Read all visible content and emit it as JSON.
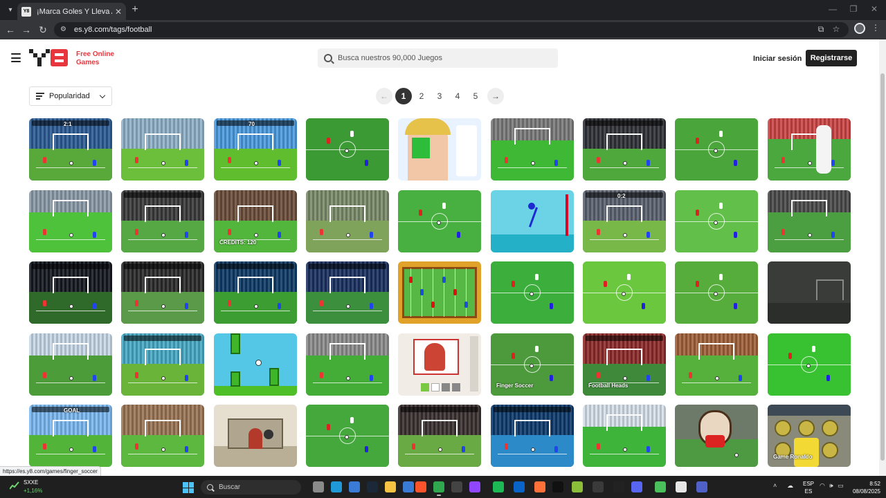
{
  "browser": {
    "tab_title": "¡Marca Goles Y Lleva A Tu Equipo",
    "favicon_text": "Y8",
    "url": "es.y8.com/tags/football",
    "status_url": "https://es.y8.com/games/finger_soccer"
  },
  "header": {
    "logo_text_line1": "Free Online",
    "logo_text_line2": "Games",
    "search_placeholder": "Busca nuestros 90,000 Juegos",
    "login_label": "Iniciar sesión",
    "register_label": "Registrarse",
    "brand_color": "#e8363e"
  },
  "controls": {
    "sort_label": "Popularidad",
    "pages": [
      "1",
      "2",
      "3",
      "4",
      "5"
    ],
    "current_page": "1",
    "prev_arrow": "←",
    "next_arrow": "→"
  },
  "games": [
    {
      "name": "game-1",
      "style": "stadium-dark",
      "sky": "#2b5b94",
      "grass": "#58a83a",
      "label": "2:1"
    },
    {
      "name": "game-2",
      "style": "penalty",
      "sky": "#8fb0c8",
      "grass": "#6bbf3b",
      "label": ""
    },
    {
      "name": "game-3",
      "style": "cartoon",
      "sky": "#4a9bdf",
      "grass": "#5fbd2e",
      "label": "70"
    },
    {
      "name": "game-4",
      "style": "topdown",
      "sky": "#3c9a35",
      "grass": "#3c9a35",
      "label": ""
    },
    {
      "name": "game-5",
      "style": "faceart",
      "sky": "#e8f3ff",
      "grass": "#bde0ff",
      "label": ""
    },
    {
      "name": "game-6",
      "style": "goal-net",
      "sky": "#7a7a7a",
      "grass": "#3fb836",
      "label": ""
    },
    {
      "name": "game-7",
      "style": "stadium-dark",
      "sky": "#303038",
      "grass": "#4ea83c",
      "label": ""
    },
    {
      "name": "game-8",
      "style": "topdown",
      "sky": "#4aa63a",
      "grass": "#4aa63a",
      "label": ""
    },
    {
      "name": "game-9",
      "style": "kicker",
      "sky": "#c44",
      "grass": "#4aa83f",
      "label": ""
    },
    {
      "name": "game-10",
      "style": "goal-net",
      "sky": "#8a9aa8",
      "grass": "#4ec23a",
      "label": ""
    },
    {
      "name": "game-11",
      "style": "stadium-dark",
      "sky": "#3a3a3a",
      "grass": "#56a845",
      "label": ""
    },
    {
      "name": "game-12",
      "style": "penalty",
      "sky": "#6b4d3a",
      "grass": "#52b63c",
      "label": "CREDITS: 120"
    },
    {
      "name": "game-13",
      "style": "field-real",
      "sky": "#7a8a6a",
      "grass": "#7fa35a",
      "label": ""
    },
    {
      "name": "game-14",
      "style": "topdown",
      "sky": "#48b040",
      "grass": "#48b040",
      "label": ""
    },
    {
      "name": "game-15",
      "style": "stickman",
      "sky": "#6cd2e6",
      "grass": "#24b0c6",
      "label": ""
    },
    {
      "name": "game-16",
      "style": "stadium-dark",
      "sky": "#5a6270",
      "grass": "#78b848",
      "label": "0:2"
    },
    {
      "name": "game-17",
      "style": "topdown",
      "sky": "#62c04a",
      "grass": "#62c04a",
      "label": ""
    },
    {
      "name": "game-18",
      "style": "goal-net",
      "sky": "#4a4a4a",
      "grass": "#4c9f40",
      "label": ""
    },
    {
      "name": "game-19",
      "style": "stadium-dark",
      "sky": "#151820",
      "grass": "#2f6a2a",
      "label": ""
    },
    {
      "name": "game-20",
      "style": "stadium-dark",
      "sky": "#2a2a2a",
      "grass": "#5a9a48",
      "label": ""
    },
    {
      "name": "game-21",
      "style": "night",
      "sky": "#0e3a66",
      "grass": "#3c9d33",
      "label": ""
    },
    {
      "name": "game-22",
      "style": "night",
      "sky": "#1a3060",
      "grass": "#3c8f3c",
      "label": ""
    },
    {
      "name": "game-23",
      "style": "foosball",
      "sky": "#e0a228",
      "grass": "#58b845",
      "label": ""
    },
    {
      "name": "game-24",
      "style": "topdown",
      "sky": "#3cae3c",
      "grass": "#3cae3c",
      "label": ""
    },
    {
      "name": "game-25",
      "style": "topdown",
      "sky": "#6ac73e",
      "grass": "#6ac73e",
      "label": ""
    },
    {
      "name": "game-26",
      "style": "topdown",
      "sky": "#56ad3c",
      "grass": "#56ad3c",
      "label": ""
    },
    {
      "name": "game-27",
      "style": "dark-room",
      "sky": "#3a3c3a",
      "grass": "#2c2e2c",
      "label": ""
    },
    {
      "name": "game-28",
      "style": "goal-net",
      "sky": "#c8d8e8",
      "grass": "#4c9c3a",
      "label": ""
    },
    {
      "name": "game-29",
      "style": "stadium-dark",
      "sky": "#46a9c6",
      "grass": "#6ab43a",
      "label": ""
    },
    {
      "name": "game-30",
      "style": "flappy",
      "sky": "#54c6e6",
      "grass": "#4fbf28",
      "label": ""
    },
    {
      "name": "game-31",
      "style": "goal-net",
      "sky": "#8c8c8c",
      "grass": "#43ad37",
      "label": ""
    },
    {
      "name": "game-32",
      "style": "card",
      "sky": "#f1ece6",
      "grass": "#dedad4",
      "label": ""
    },
    {
      "name": "game-33",
      "style": "topdown",
      "sky": "#4d9a3d",
      "grass": "#4d9a3d",
      "label": "Finger Soccer"
    },
    {
      "name": "game-34",
      "style": "stadium-dark",
      "sky": "#8c2a2a",
      "grass": "#3f8a3a",
      "label": "Football Heads"
    },
    {
      "name": "game-35",
      "style": "goal-net",
      "sky": "#a0603a",
      "grass": "#55b13b",
      "label": ""
    },
    {
      "name": "game-36",
      "style": "topdown",
      "sky": "#38c232",
      "grass": "#38c232",
      "label": ""
    },
    {
      "name": "game-37",
      "style": "cartoon",
      "sky": "#7bb8f0",
      "grass": "#52b53a",
      "label": "GOAL"
    },
    {
      "name": "game-38",
      "style": "penalty",
      "sky": "#9a7454",
      "grass": "#5cb83e",
      "label": ""
    },
    {
      "name": "game-39",
      "style": "castle",
      "sky": "#e6dfcf",
      "grass": "#b9ae96",
      "label": ""
    },
    {
      "name": "game-40",
      "style": "topdown",
      "sky": "#44a83c",
      "grass": "#44a83c",
      "label": ""
    },
    {
      "name": "game-41",
      "style": "stadium-dark",
      "sky": "#3a3030",
      "grass": "#6aaa44",
      "label": ""
    },
    {
      "name": "game-42",
      "style": "night",
      "sky": "#0d3a6c",
      "grass": "#2c8ac8",
      "label": ""
    },
    {
      "name": "game-43",
      "style": "goal-net",
      "sky": "#d6e0ea",
      "grass": "#3eb43a",
      "label": ""
    },
    {
      "name": "game-44",
      "style": "mascot",
      "sky": "#6d7a6a",
      "grass": "#4e9a42",
      "label": ""
    },
    {
      "name": "game-45",
      "style": "ronaldo",
      "sky": "#8a8a7a",
      "grass": "#d9c455",
      "label": "Game Ronaldo"
    }
  ],
  "taskbar": {
    "stock_name": "SXXE",
    "stock_change": "+1,16%",
    "search_label": "Buscar",
    "lang_line1": "ESP",
    "lang_line2": "ES",
    "time": "8:52",
    "date": "08/08/2025"
  }
}
